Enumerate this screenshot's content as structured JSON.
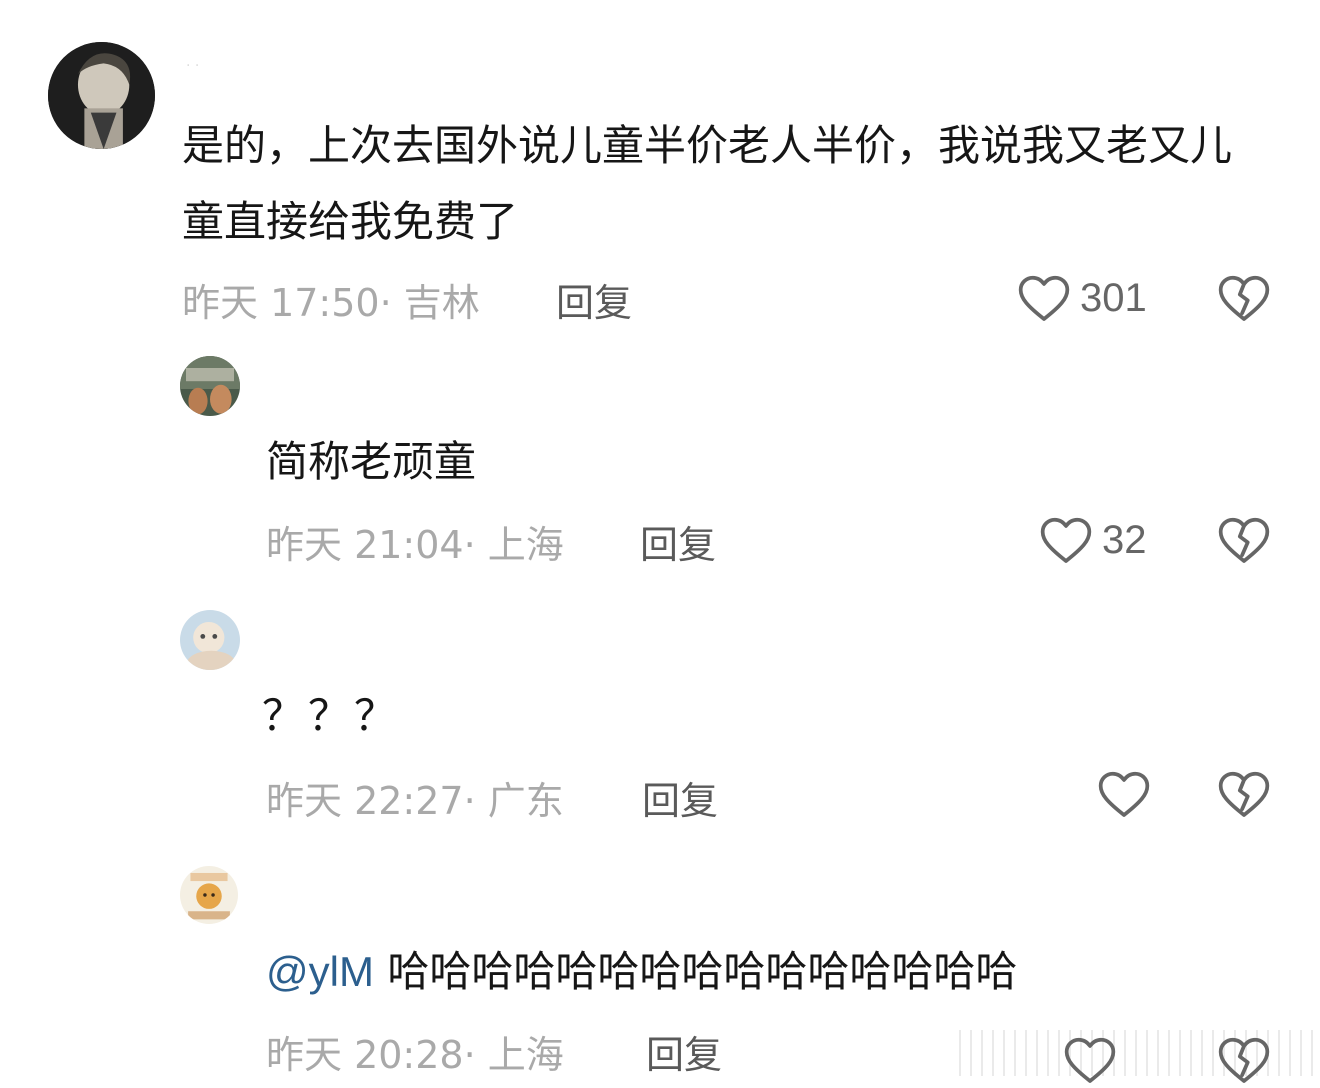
{
  "comments": [
    {
      "content": "是的，上次去国外说儿童半价老人半价，我说我又老又儿童直接给我免费了",
      "time_location": "昨天 17:50· 吉林",
      "reply_label": "回复",
      "like_count": "301"
    },
    {
      "content": "简称老顽童",
      "time_location": "昨天 21:04· 上海",
      "reply_label": "回复",
      "like_count": "32"
    },
    {
      "content": "？？？",
      "time_location": "昨天 22:27· 广东",
      "reply_label": "回复",
      "like_count": ""
    },
    {
      "mention": "@ylM",
      "content": "哈哈哈哈哈哈哈哈哈哈哈哈哈哈哈",
      "time_location": "昨天 20:28· 上海",
      "reply_label": "回复",
      "like_count": ""
    }
  ],
  "icons": {
    "like": "heart-outline-icon",
    "dislike": "broken-heart-icon"
  },
  "colors": {
    "text": "#161616",
    "meta": "#a9a9a9",
    "reply": "#5a5a5a",
    "icon": "#666666",
    "mention": "#2c5f8e"
  }
}
